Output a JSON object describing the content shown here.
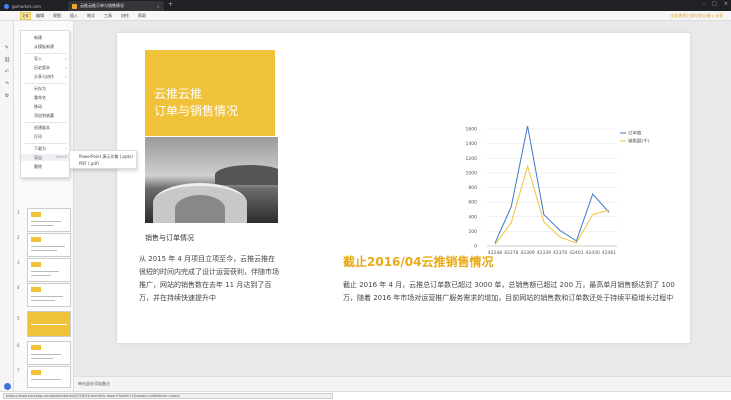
{
  "browser": {
    "tabs": [
      {
        "label": "gomarket.com"
      },
      {
        "label": "云推云推订单与销售情况"
      }
    ],
    "url_preview": "https://www.kmxapp.com/presentation/2016/04/monthly-report?sheet=1&mode=edit&from=share"
  },
  "toolbar": {
    "file_label": "文件",
    "menus": [
      "编辑",
      "视图",
      "插入",
      "格式",
      "工具",
      "协作",
      "帮助"
    ],
    "right_text": "全部更改已保存到云端 ▸ 分享"
  },
  "file_menu": {
    "items": [
      {
        "label": "新建",
        "submenu": false
      },
      {
        "label": "从模板新建",
        "submenu": false
      },
      {
        "label": "导入",
        "submenu": true
      },
      {
        "label": "历史版本",
        "submenu": true
      },
      {
        "label": "分享与协作",
        "submenu": true
      },
      {
        "label": "另存为",
        "submenu": false
      },
      {
        "label": "重命名",
        "submenu": false
      },
      {
        "label": "移动",
        "submenu": false
      },
      {
        "label": "添加到收藏",
        "submenu": false
      },
      {
        "label": "创建副本",
        "submenu": false
      },
      {
        "label": "打印",
        "submenu": false
      },
      {
        "label": "下载为",
        "submenu": true
      },
      {
        "label": "导出",
        "submenu": true,
        "highlight": true,
        "hotkey": "Ctrl+E"
      },
      {
        "label": "删除",
        "submenu": false
      }
    ],
    "export_submenu": [
      "PowerPoint 演示文稿 (.pptx)",
      "PDF (.pdf)"
    ]
  },
  "thumbnails": {
    "numbers": [
      "1",
      "2",
      "3",
      "4",
      "5",
      "6",
      "7"
    ]
  },
  "slide": {
    "title_line1": "云推云推",
    "title_line2": "订单与销售情况",
    "section_heading": "销售与订单情况",
    "left_paragraph": "从 2015 年 4 月项目立项至今，云推云推在很短的时间内完成了设计运营获利，伴随市场推广，网站的销售数在去年 11 月达到了百万，并在持续快速提升中",
    "big_heading": "截止2016/04云推销售情况",
    "right_paragraph": "截止 2016 年 4 月，云推总订单数已超过 3000 单，总销售额已超过 200 万，最高单月销售额达到了 100 万，随着 2016 年市场对运营推广服务需求的增加，目前网站的销售数和订单数还处于持续平稳增长过程中"
  },
  "chart_data": {
    "type": "line",
    "x": [
      "42248",
      "42278",
      "42309",
      "42339",
      "42370",
      "42401",
      "42430",
      "42461"
    ],
    "series": [
      {
        "name": "订单数",
        "color": "#3c78c8",
        "values": [
          40,
          540,
          1640,
          430,
          210,
          70,
          710,
          460
        ]
      },
      {
        "name": "销售额(千)",
        "color": "#f0c23a",
        "values": [
          20,
          320,
          1090,
          330,
          120,
          40,
          430,
          490
        ]
      }
    ],
    "yticks": [
      "0",
      "200",
      "400",
      "600",
      "800",
      "1000",
      "1200",
      "1400",
      "1600"
    ],
    "ylim": [
      0,
      1600
    ],
    "grid": true,
    "legend": "top-right"
  },
  "notes": {
    "placeholder": "单击此处添加备注"
  }
}
